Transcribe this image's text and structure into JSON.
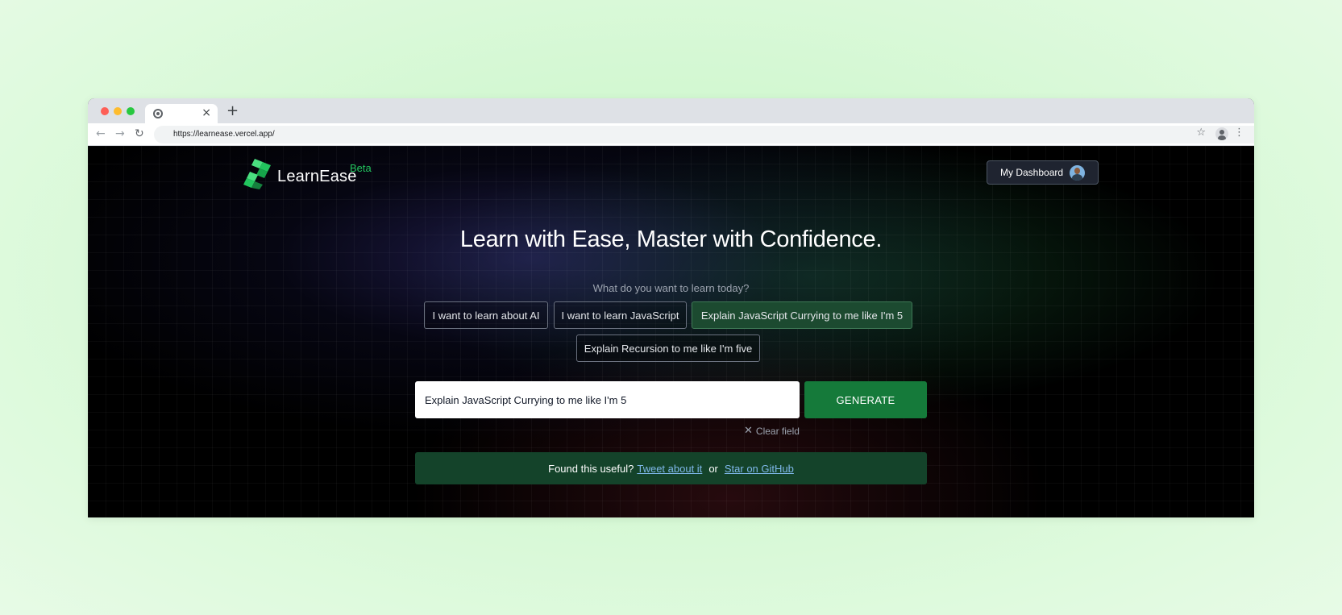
{
  "browser": {
    "url": "https://learnease.vercel.app/",
    "new_tab_glyph": "+",
    "tab_close_glyph": "×"
  },
  "header": {
    "logo_text": "LearnEase",
    "beta_label": "Beta",
    "dashboard_label": "My Dashboard"
  },
  "hero": {
    "headline": "Learn with Ease, Master with Confidence.",
    "prompt": "What do you want to learn today?"
  },
  "suggestions": [
    {
      "label": "I want to learn about AI",
      "active": false
    },
    {
      "label": "I want to learn JavaScript",
      "active": false
    },
    {
      "label": "Explain JavaScript Currying to me like I'm 5",
      "active": true
    },
    {
      "label": "Explain Recursion to me like I'm five",
      "active": false
    }
  ],
  "form": {
    "input_value": "Explain JavaScript Currying to me like I'm 5",
    "generate_label": "GENERATE",
    "clear_label": "Clear field"
  },
  "banner": {
    "lead": "Found this useful?",
    "tweet_label": "Tweet about it",
    "or_label": "or",
    "github_label": "Star on GitHub"
  },
  "colors": {
    "accent_green": "#157a3a",
    "beta_green": "#22c55e",
    "link_blue": "#7fb8ea",
    "page_bg": "#000000"
  }
}
